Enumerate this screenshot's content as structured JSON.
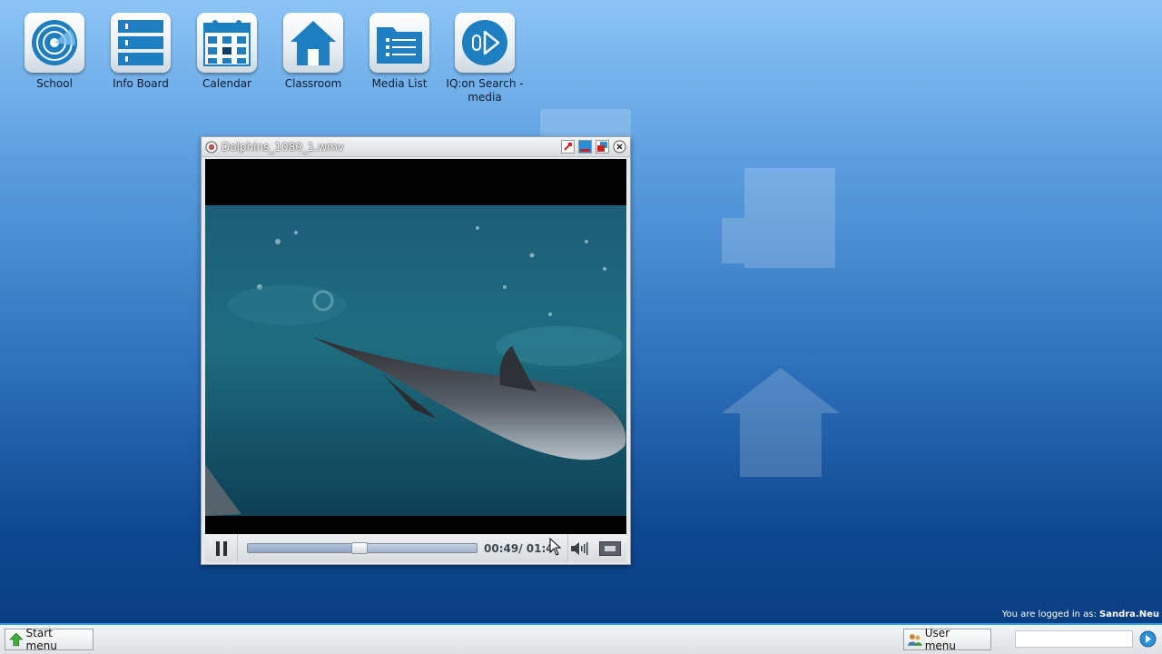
{
  "desktop": {
    "icons": [
      {
        "label": "School",
        "icon": "radar-icon"
      },
      {
        "label": "Info Board",
        "icon": "info-board-icon"
      },
      {
        "label": "Calendar",
        "icon": "calendar-icon"
      },
      {
        "label": "Classroom",
        "icon": "house-icon"
      },
      {
        "label": "Media List",
        "icon": "folder-list-icon"
      },
      {
        "label": "IQ:on Search -\nmedia",
        "icon": "play-search-icon"
      }
    ]
  },
  "media_window": {
    "title": "Dolphins_1080_1.wmv",
    "video_subject": "dolphin swimming underwater",
    "time_readout": "00:49/ 01:4",
    "progress_fraction": 0.49
  },
  "status": {
    "logged_in_prefix": "You are logged in as:",
    "logged_in_user": "Sandra.Neu"
  },
  "taskbar": {
    "start_label": "Start menu",
    "user_menu_label": "User menu",
    "search_value": ""
  },
  "colors": {
    "accent": "#2f9be0",
    "icon_blue": "#1d7fc0"
  }
}
